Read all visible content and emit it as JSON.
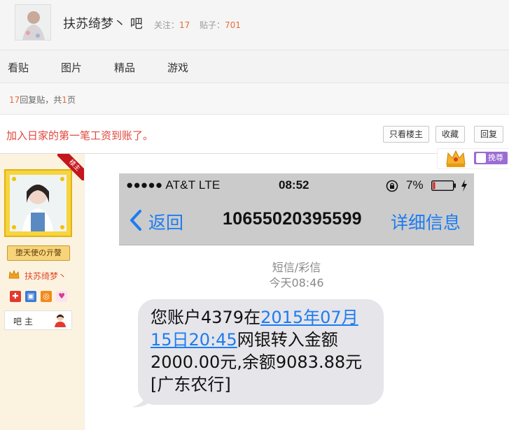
{
  "forum": {
    "name": "扶苏绮梦丶 吧",
    "follow_label": "关注：",
    "follow_count": "17",
    "posts_label": "贴子：",
    "posts_count": "701"
  },
  "nav": {
    "tabs": [
      "看贴",
      "图片",
      "精品",
      "游戏"
    ]
  },
  "pager": {
    "reply_count": "17",
    "reply_label": "回复贴，共",
    "page_count": "1",
    "page_label": "页"
  },
  "thread": {
    "title": "加入日家的第一笔工资到账了。",
    "op_only_label": "只看楼主",
    "favorite_label": "收藏",
    "reply_label": "回复"
  },
  "medal": {
    "button_label": "挽尊"
  },
  "author": {
    "op_tag": "楼主",
    "title_badge": "堕天使の亓謦",
    "name": "扶苏绮梦丶",
    "bazhu_label": "吧 主"
  },
  "phone": {
    "carrier": "●●●●● AT&T  LTE",
    "time": "08:52",
    "battery": "7%",
    "back_label": "返回",
    "sender": "10655020395599",
    "detail_label": "详细信息",
    "message_type": "短信/彩信",
    "message_time": "今天08:46",
    "message_part1": "您账户4379在",
    "message_link": "2015年07月15日20:45",
    "message_part2": "网银转入金额2000.00元,余额9083.88元[广东农行]"
  },
  "colors": {
    "accent_orange": "#e56c3b",
    "title_red": "#e0483c",
    "ios_blue": "#1d7cf2",
    "medal_purple": "#9b6cd4"
  }
}
